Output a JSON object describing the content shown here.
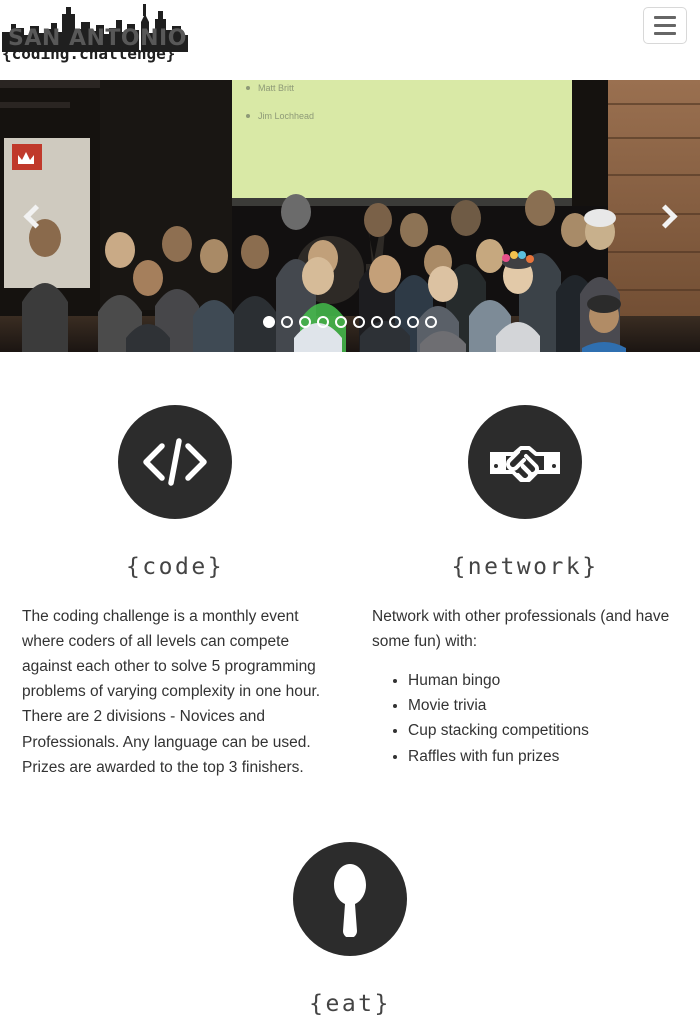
{
  "header": {
    "brand_city": "SAN ANTONIO",
    "brand_sub": "{coding.challenge}",
    "menu_label": "Toggle navigation"
  },
  "carousel": {
    "prev_label": "Previous",
    "next_label": "Next",
    "slide_alt": "Group photo of San Antonio Coding Challenge participants",
    "active_index": 0,
    "indicators": [
      "1",
      "2",
      "3",
      "4",
      "5",
      "6",
      "7",
      "8",
      "9",
      "10"
    ],
    "photo": {
      "screen_line_1": "Matt Britt",
      "screen_line_2": "Jim Lochhead",
      "screen_color": "#d9e9a6",
      "wall_color": "#8a6244",
      "backdrop_color": "#15120f"
    }
  },
  "features": [
    {
      "icon": "code-icon",
      "title": "{code}",
      "body": "The coding challenge is a monthly event where coders of all levels can compete against each other to solve 5 programming problems of varying complexity in one hour. There are 2 divisions - Novices and Professionals. Any language can be used. Prizes are awarded to the top 3 finishers.",
      "items": []
    },
    {
      "icon": "handshake-icon",
      "title": "{network}",
      "body": "Network with other professionals (and have some fun) with:",
      "items": [
        "Human bingo",
        "Movie trivia",
        "Cup stacking competitions",
        "Raffles with fun prizes"
      ]
    },
    {
      "icon": "spoon-icon",
      "title": "{eat}",
      "body": "",
      "items": []
    }
  ],
  "colors": {
    "icon_circle": "#2c2c2c",
    "icon_glyph": "#ffffff",
    "heading": "#444444",
    "text": "#333333",
    "menu_border": "#d8d8d8",
    "menu_bar": "#666666"
  }
}
